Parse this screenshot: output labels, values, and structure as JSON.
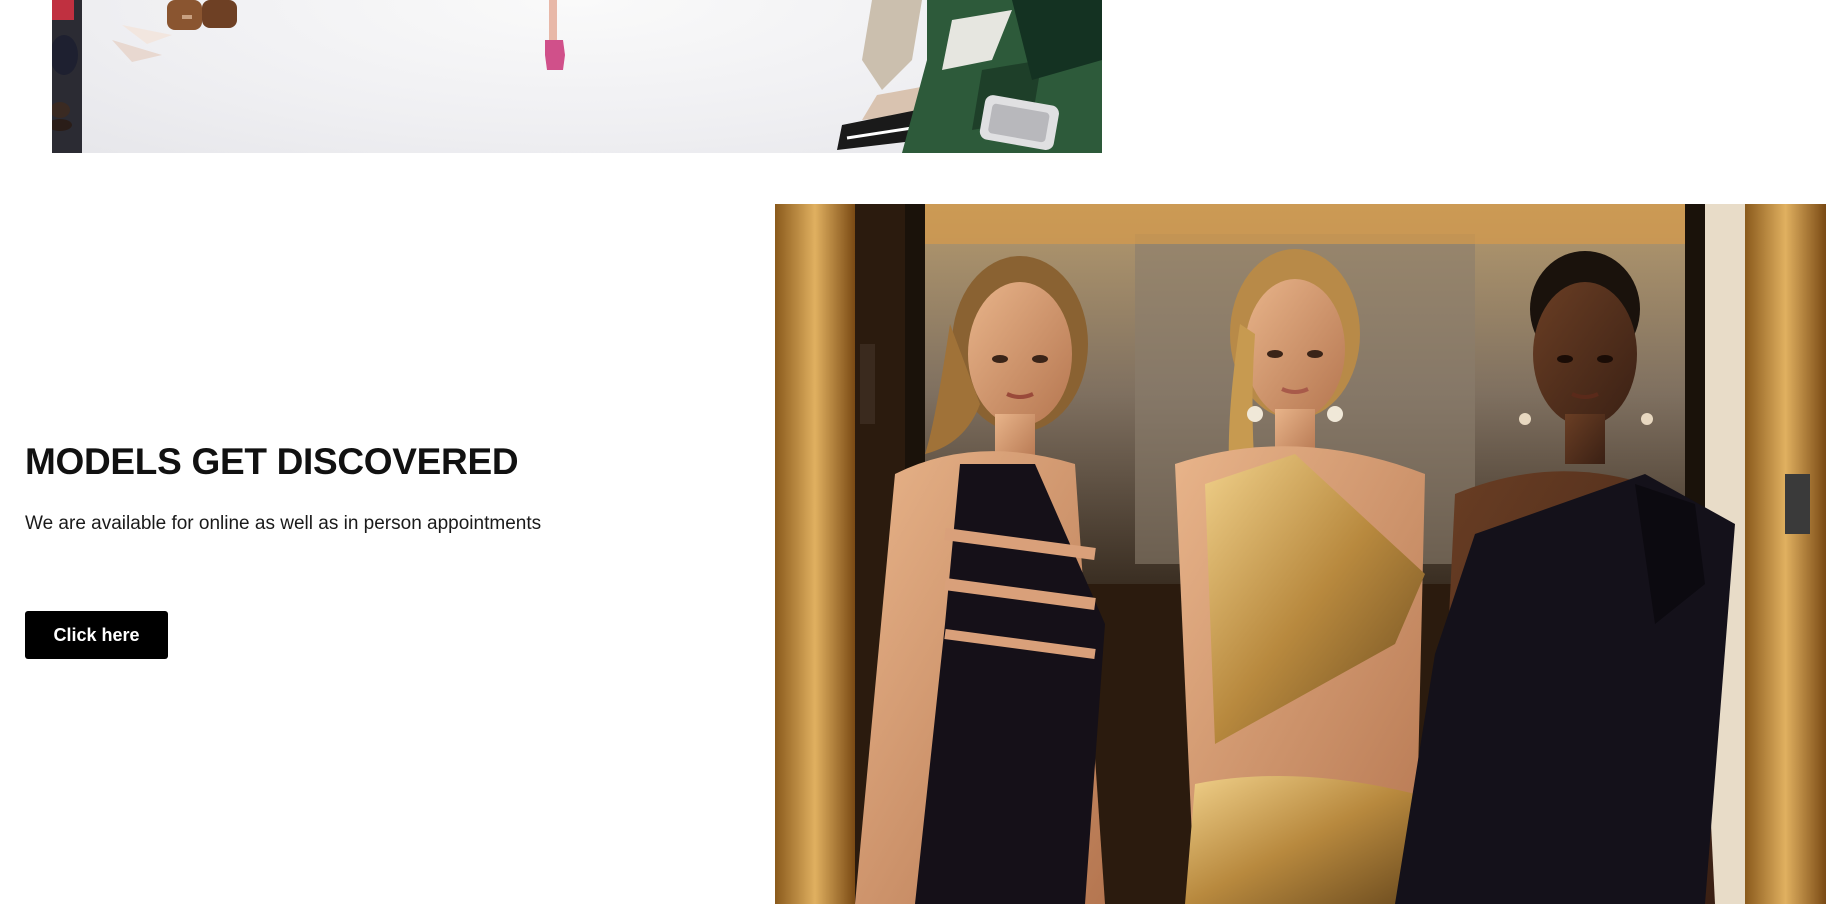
{
  "hero": {
    "title": "MODELS GET DISCOVERED",
    "subtitle": "We are available for online as well as in person appointments",
    "cta_label": "Click here"
  },
  "images": {
    "runway": "runway-photo",
    "models": "three-models-photo"
  },
  "colors": {
    "text": "#111111",
    "button_bg": "#000000",
    "button_text": "#ffffff",
    "background": "#ffffff"
  }
}
